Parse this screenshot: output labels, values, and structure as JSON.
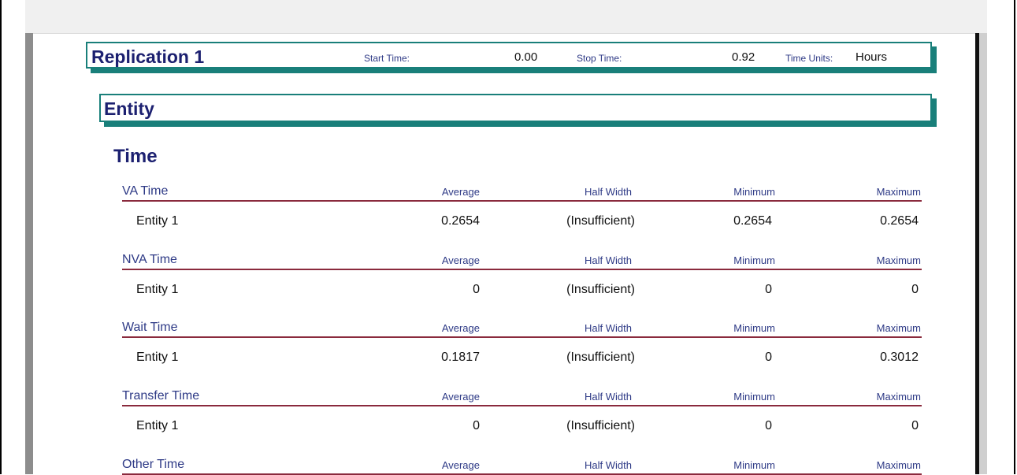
{
  "replication": {
    "title": "Replication 1",
    "start_time_label": "Start Time:",
    "start_time_value": "0.00",
    "stop_time_label": "Stop Time:",
    "stop_time_value": "0.92",
    "time_units_label": "Time Units:",
    "time_units_value": "Hours"
  },
  "entity_header": "Entity",
  "time_header": "Time",
  "columns": {
    "average": "Average",
    "half_width": "Half Width",
    "minimum": "Minimum",
    "maximum": "Maximum"
  },
  "sections": [
    {
      "title": "VA Time",
      "rows": [
        {
          "label": "Entity 1",
          "average": "0.2654",
          "half_width": "(Insufficient)",
          "minimum": "0.2654",
          "maximum": "0.2654"
        }
      ]
    },
    {
      "title": "NVA Time",
      "rows": [
        {
          "label": "Entity 1",
          "average": "0",
          "half_width": "(Insufficient)",
          "minimum": "0",
          "maximum": "0"
        }
      ]
    },
    {
      "title": "Wait Time",
      "rows": [
        {
          "label": "Entity 1",
          "average": "0.1817",
          "half_width": "(Insufficient)",
          "minimum": "0",
          "maximum": "0.3012"
        }
      ]
    },
    {
      "title": "Transfer Time",
      "rows": [
        {
          "label": "Entity 1",
          "average": "0",
          "half_width": "(Insufficient)",
          "minimum": "0",
          "maximum": "0"
        }
      ]
    },
    {
      "title": "Other Time",
      "rows": []
    }
  ]
}
